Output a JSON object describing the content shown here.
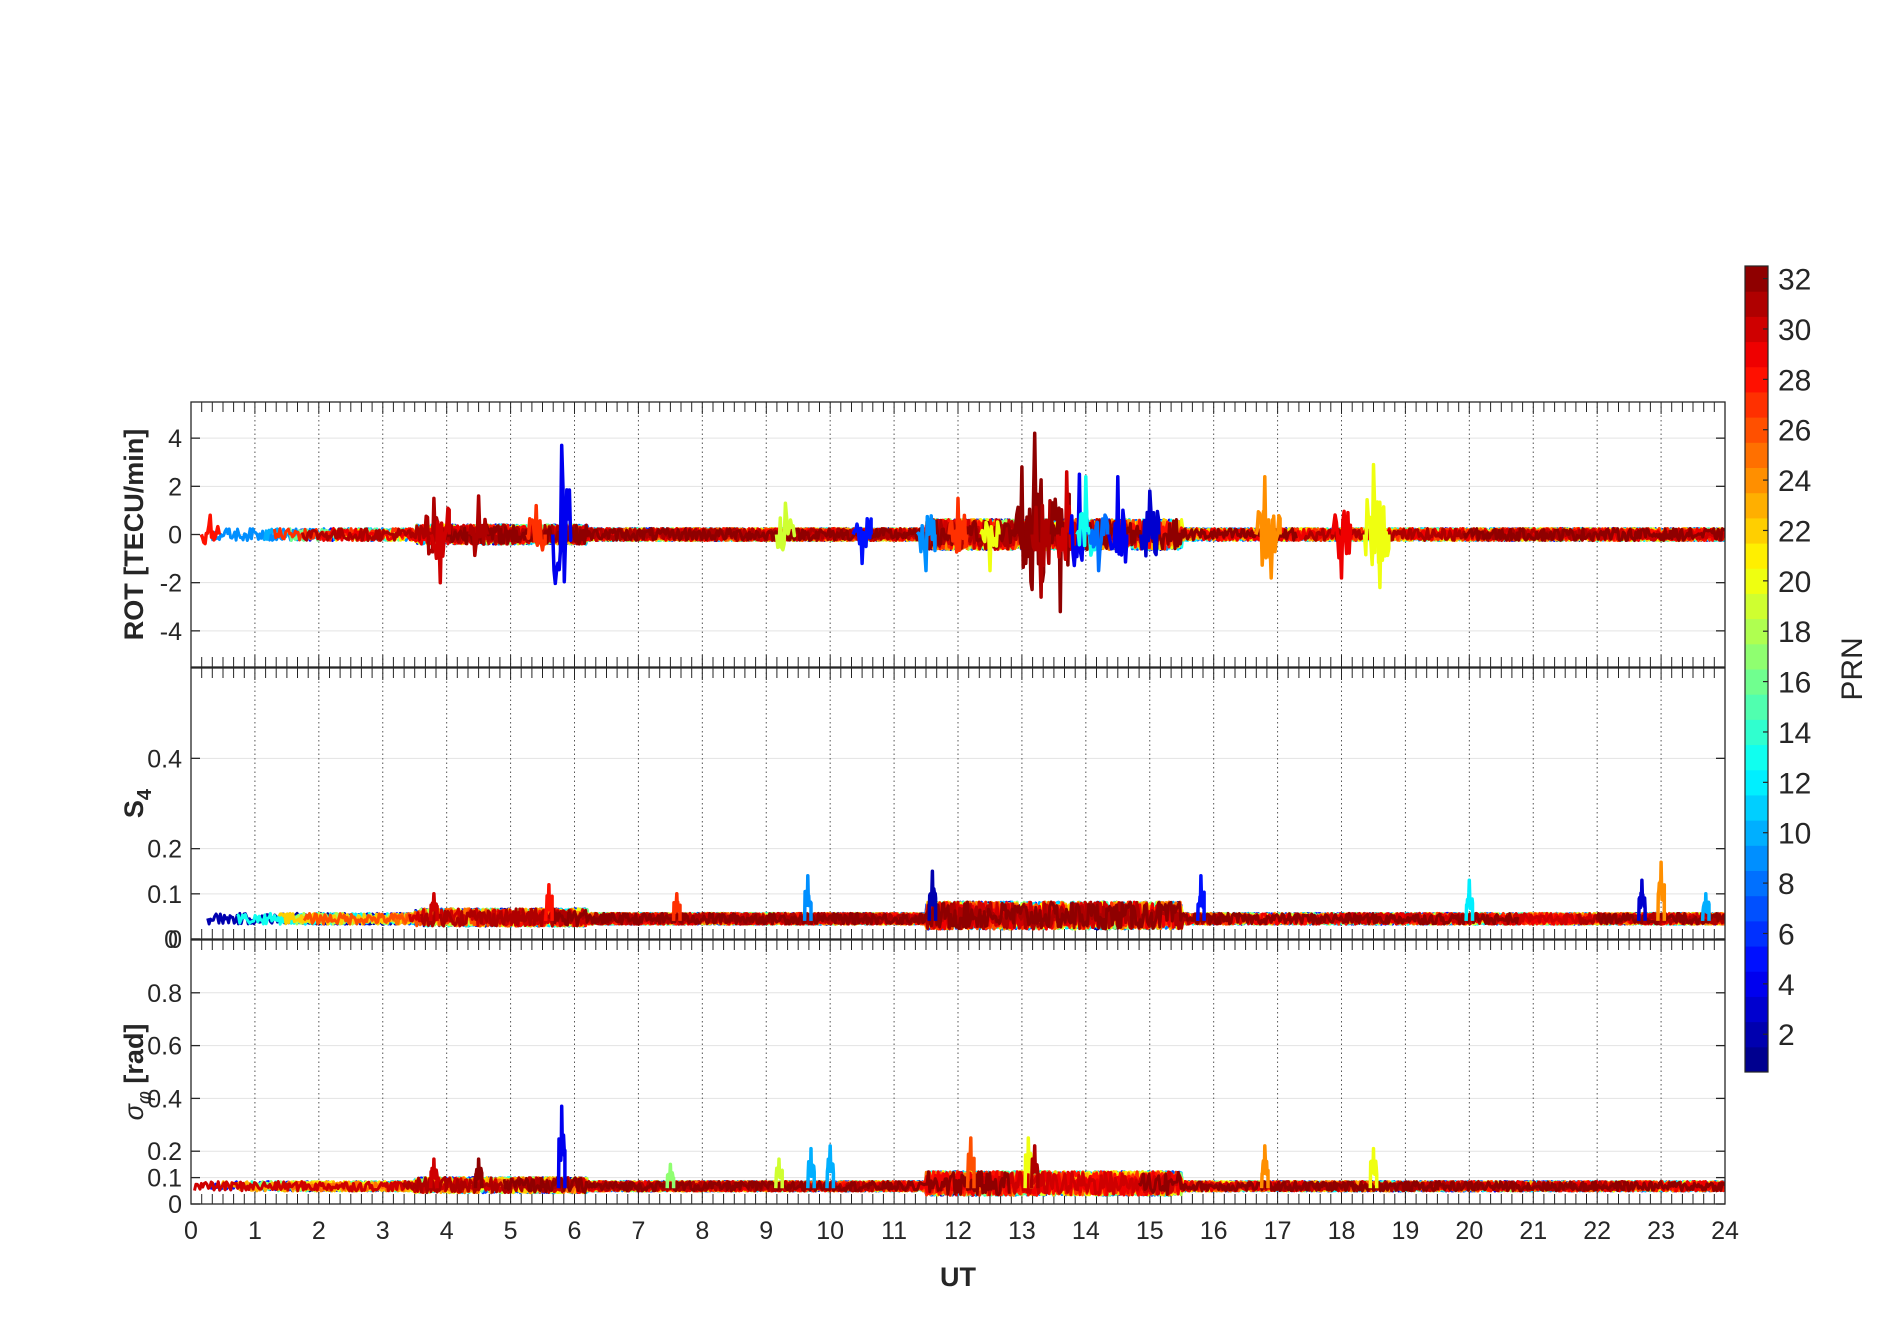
{
  "chart_data": [
    {
      "type": "line",
      "panel": "rot",
      "ylabel": "ROT [TECU/min]",
      "ylim": [
        -5.5,
        5.5
      ],
      "yticks": [
        -4,
        -2,
        0,
        2,
        4
      ],
      "xlim": [
        0,
        24
      ],
      "grid": true,
      "color_by": "PRN",
      "baseline_amplitude": 0.25,
      "events": [
        {
          "prn": 28,
          "t": 0.3,
          "amp": 0.8
        },
        {
          "prn": 31,
          "t": 3.8,
          "amp": 1.5
        },
        {
          "prn": 30,
          "t": 3.9,
          "amp": -2.0
        },
        {
          "prn": 31,
          "t": 4.5,
          "amp": 1.6
        },
        {
          "prn": 4,
          "t": 5.8,
          "amp": 3.7
        },
        {
          "prn": 27,
          "t": 5.4,
          "amp": 1.2
        },
        {
          "prn": 19,
          "t": 9.3,
          "amp": 1.3
        },
        {
          "prn": 5,
          "t": 10.5,
          "amp": -1.2
        },
        {
          "prn": 9,
          "t": 11.5,
          "amp": -1.5
        },
        {
          "prn": 27,
          "t": 12.0,
          "amp": 1.5
        },
        {
          "prn": 20,
          "t": 12.5,
          "amp": -1.5
        },
        {
          "prn": 32,
          "t": 13.0,
          "amp": 2.8
        },
        {
          "prn": 32,
          "t": 13.2,
          "amp": 4.2
        },
        {
          "prn": 31,
          "t": 13.3,
          "amp": -2.6
        },
        {
          "prn": 32,
          "t": 13.6,
          "amp": -3.2
        },
        {
          "prn": 30,
          "t": 13.7,
          "amp": 2.6
        },
        {
          "prn": 4,
          "t": 13.9,
          "amp": 2.5
        },
        {
          "prn": 4,
          "t": 14.5,
          "amp": 2.4
        },
        {
          "prn": 13,
          "t": 14.0,
          "amp": 2.4
        },
        {
          "prn": 8,
          "t": 14.2,
          "amp": -1.5
        },
        {
          "prn": 3,
          "t": 15.0,
          "amp": 1.8
        },
        {
          "prn": 24,
          "t": 16.8,
          "amp": 2.4
        },
        {
          "prn": 24,
          "t": 16.9,
          "amp": -1.8
        },
        {
          "prn": 29,
          "t": 18.0,
          "amp": -1.8
        },
        {
          "prn": 20,
          "t": 18.5,
          "amp": 2.9
        },
        {
          "prn": 20,
          "t": 18.6,
          "amp": -2.2
        }
      ]
    },
    {
      "type": "line",
      "panel": "s4",
      "ylabel": "S",
      "ylabel_sub": "4",
      "ylim": [
        0,
        0.6
      ],
      "yticks": [
        0,
        0.1,
        0.2,
        0.4
      ],
      "extra_tick_label": "0",
      "xlim": [
        0,
        24
      ],
      "grid": true,
      "color_by": "PRN",
      "baseline": 0.04,
      "events": [
        {
          "prn": 9,
          "t": 9.65,
          "amp": 0.14
        },
        {
          "prn": 2,
          "t": 11.6,
          "amp": 0.15
        },
        {
          "prn": 5,
          "t": 15.8,
          "amp": 0.14
        },
        {
          "prn": 12,
          "t": 20.0,
          "amp": 0.13
        },
        {
          "prn": 3,
          "t": 22.7,
          "amp": 0.13
        },
        {
          "prn": 24,
          "t": 23.0,
          "amp": 0.17
        },
        {
          "prn": 28,
          "t": 5.6,
          "amp": 0.12
        },
        {
          "prn": 30,
          "t": 3.8,
          "amp": 0.1
        },
        {
          "prn": 27,
          "t": 7.6,
          "amp": 0.1
        },
        {
          "prn": 10,
          "t": 23.7,
          "amp": 0.1
        }
      ]
    },
    {
      "type": "line",
      "panel": "sigma",
      "ylabel": "σ",
      "ylabel_sub": "φ",
      "ylabel_unit": " [rad]",
      "ylim": [
        0,
        1
      ],
      "yticks": [
        0,
        0.1,
        0.2,
        0.4,
        0.6,
        0.8
      ],
      "xlim": [
        0,
        24
      ],
      "xticks": [
        0,
        1,
        2,
        3,
        4,
        5,
        6,
        7,
        8,
        9,
        10,
        11,
        12,
        13,
        14,
        15,
        16,
        17,
        18,
        19,
        20,
        21,
        22,
        23,
        24
      ],
      "xlabel": "UT",
      "grid": true,
      "color_by": "PRN",
      "baseline": 0.06,
      "events": [
        {
          "prn": 4,
          "t": 5.8,
          "amp": 0.37
        },
        {
          "prn": 26,
          "t": 12.2,
          "amp": 0.25
        },
        {
          "prn": 20,
          "t": 13.1,
          "amp": 0.25
        },
        {
          "prn": 31,
          "t": 13.2,
          "amp": 0.22
        },
        {
          "prn": 24,
          "t": 16.8,
          "amp": 0.22
        },
        {
          "prn": 20,
          "t": 18.5,
          "amp": 0.21
        },
        {
          "prn": 10,
          "t": 9.7,
          "amp": 0.21
        },
        {
          "prn": 10,
          "t": 10.0,
          "amp": 0.22
        },
        {
          "prn": 30,
          "t": 3.8,
          "amp": 0.17
        },
        {
          "prn": 32,
          "t": 4.5,
          "amp": 0.17
        },
        {
          "prn": 17,
          "t": 7.5,
          "amp": 0.15
        },
        {
          "prn": 19,
          "t": 9.2,
          "amp": 0.17
        }
      ]
    }
  ],
  "colorbar": {
    "label": "PRN",
    "min": 1,
    "max": 32,
    "ticks": [
      2,
      4,
      6,
      8,
      10,
      12,
      14,
      16,
      18,
      20,
      22,
      24,
      26,
      28,
      30,
      32
    ],
    "colormap": "jet",
    "levels": 32
  }
}
